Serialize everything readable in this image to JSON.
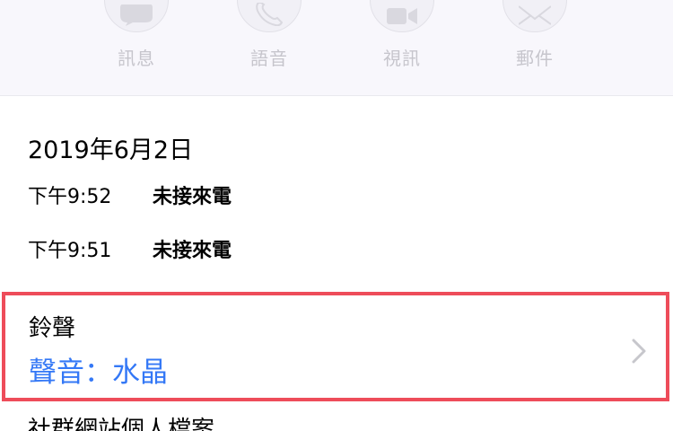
{
  "actions": {
    "message": {
      "label": "訊息",
      "icon": "message-bubble-icon"
    },
    "voice": {
      "label": "語音",
      "icon": "phone-icon"
    },
    "video": {
      "label": "視訊",
      "icon": "video-camera-icon"
    },
    "mail": {
      "label": "郵件",
      "icon": "envelope-icon"
    }
  },
  "history": {
    "date": "2019年6月2日",
    "calls": [
      {
        "time": "下午9:52",
        "status": "未接來電"
      },
      {
        "time": "下午9:51",
        "status": "未接來電"
      }
    ]
  },
  "ringtone": {
    "title": "鈴聲",
    "value": "聲音：水晶",
    "chevron_icon": "chevron-right-icon"
  },
  "next_row": {
    "label": "社群網站個人檔案"
  },
  "colors": {
    "accent": "#3478f6",
    "highlight_border": "#ee4c5a",
    "disabled_label": "#c6c5cc",
    "action_bar_bg": "#f8f7fc"
  }
}
